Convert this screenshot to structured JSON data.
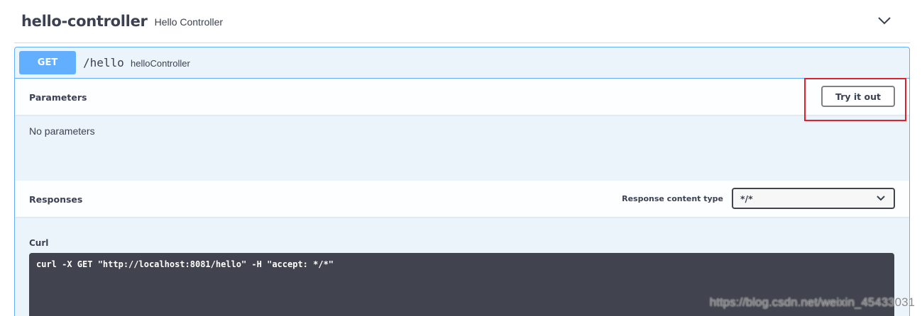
{
  "tag": {
    "title": "hello-controller",
    "description": "Hello Controller",
    "toggle_icon": "chevron-down-icon"
  },
  "operation": {
    "method": "GET",
    "path": "/hello",
    "description": "helloController",
    "method_color": "#61affe"
  },
  "parameters": {
    "title": "Parameters",
    "try_button_label": "Try it out",
    "empty_text": "No parameters"
  },
  "responses": {
    "title": "Responses",
    "content_type_label": "Response content type",
    "content_type_value": "*/*",
    "select_icon": "chevron-down-icon"
  },
  "curl": {
    "label": "Curl",
    "command": "curl -X GET \"http://localhost:8081/hello\" -H \"accept: */*\""
  },
  "watermark": {
    "text": "https://blog.csdn.net/weixin_45433031"
  },
  "colors": {
    "highlight": "#e0202b",
    "code_background": "#41444e",
    "block_background": "#ebf3fb"
  }
}
